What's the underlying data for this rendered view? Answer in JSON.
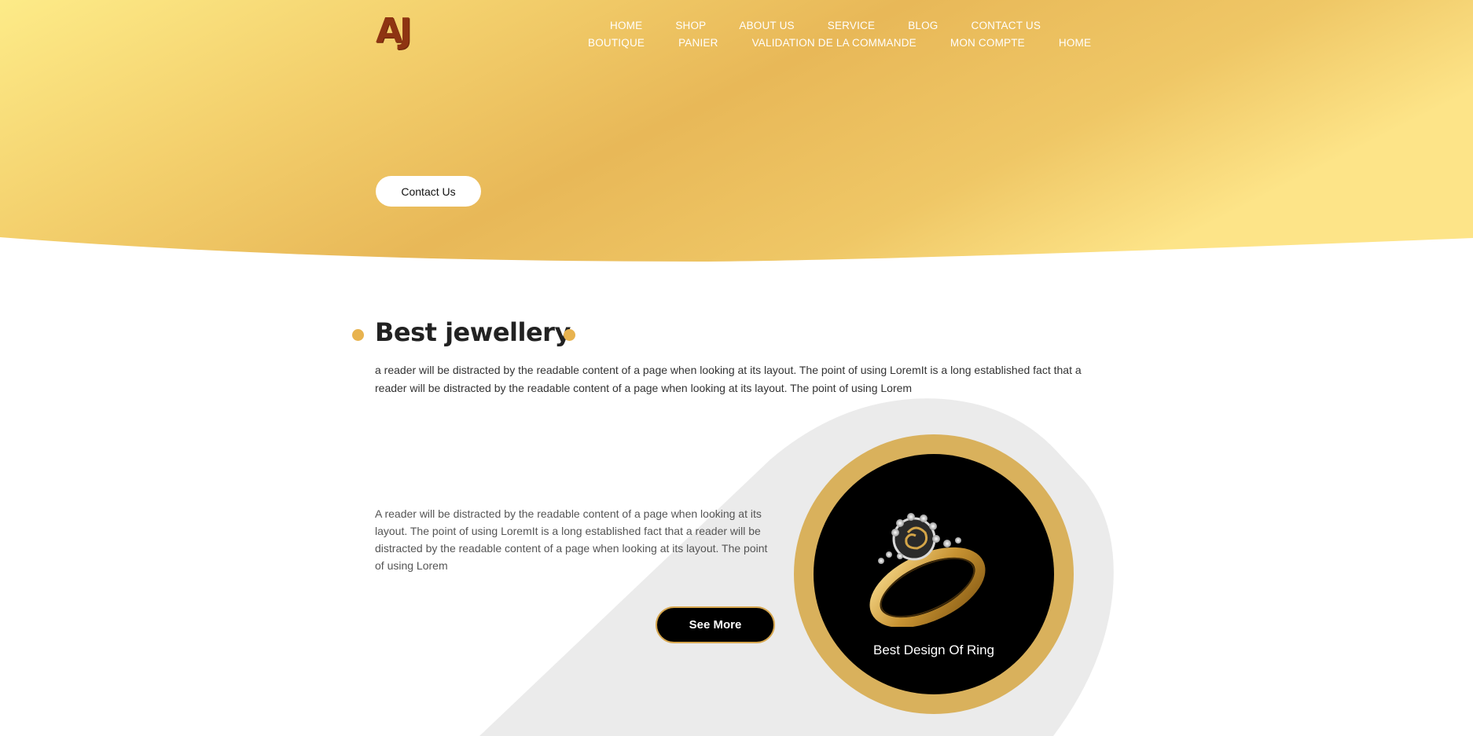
{
  "brand": {
    "logo_text": "AJ"
  },
  "nav": {
    "row1": [
      "HOME",
      "SHOP",
      "ABOUT US",
      "SERVICE",
      "BLOG",
      "CONTACT US"
    ],
    "row2": [
      "BOUTIQUE",
      "PANIER",
      "VALIDATION DE LA COMMANDE",
      "MON COMPTE",
      "HOME"
    ]
  },
  "hero": {
    "contact_button": "Contact Us"
  },
  "section": {
    "title": "Best jewellery",
    "intro": "a reader will be distracted by the readable content of a page when looking at its layout. The point of using LoremIt is a long established fact that a reader will be distracted by the readable content of a page when looking at its layout. The point of using Lorem",
    "body": "A reader will be distracted by the readable content of a page when looking at its layout. The point of using LoremIt is a long established fact that a reader will be distracted by the readable content of a page when looking at its layout. The point of using Lorem",
    "see_more": "See More",
    "product_caption": "Best Design Of Ring"
  },
  "colors": {
    "gold_light": "#fde88a",
    "gold_dark": "#e8b85a",
    "accent_dot": "#e8b34f",
    "logo": "#8e3412",
    "ring_border": "#d9b15c"
  },
  "icons": {
    "product": "gold-ring-icon"
  }
}
